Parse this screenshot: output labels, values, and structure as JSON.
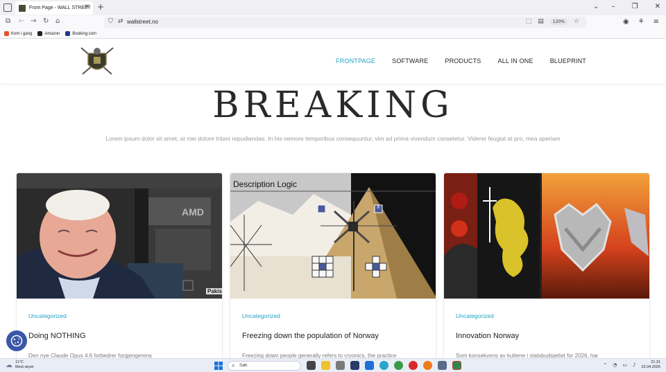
{
  "browser": {
    "tab_title": "Front Page - WALL STREET",
    "url": "wallstreet.no",
    "zoom": "120%",
    "bookmarks": [
      {
        "label": "Kom i gang",
        "color": "#e0532c"
      },
      {
        "label": "Amazon",
        "color": "#222222"
      },
      {
        "label": "Booking.com",
        "color": "#1f3c88"
      }
    ]
  },
  "site": {
    "menu": [
      {
        "label": "FRONTPAGE",
        "active": true
      },
      {
        "label": "SOFTWARE",
        "active": false
      },
      {
        "label": "PRODUCTS",
        "active": false
      },
      {
        "label": "ALL IN ONE",
        "active": false
      },
      {
        "label": "BLUEPRINT",
        "active": false
      }
    ],
    "hero_title": "BREAKING",
    "hero_subtitle": "Lorem ipsum dolor sit amet, at mei dolore tritani repudiandae. In his nemore temporibus consequuntur, vim ad prima vivendum consetetur. Viderer feugiat at pro, mea aperiam",
    "accent_color": "#22a3c3",
    "cards": [
      {
        "category": "Uncategorized",
        "title": "Doing NOTHING",
        "excerpt": "Den nye Claude Opus 4.6 forbedrer forgjengerens",
        "image_labels": [
          "AMD",
          "Pakis"
        ]
      },
      {
        "category": "Uncategorized",
        "title": "Freezing down the population of Norway",
        "excerpt": "Freezing down people generally refers to cryonics, the practice",
        "image_labels": [
          "Description Logic",
          "X"
        ]
      },
      {
        "category": "Uncategorized",
        "title": "Innovation Norway",
        "excerpt": "Som konsekvens av kuttene i statsbudsjettet for 2026, har",
        "image_labels": []
      }
    ]
  },
  "taskbar": {
    "weather_temp": "11°C",
    "weather_desc": "Mest skyet",
    "search_placeholder": "Søk",
    "time": "21:31",
    "date": "22.04.2026"
  }
}
